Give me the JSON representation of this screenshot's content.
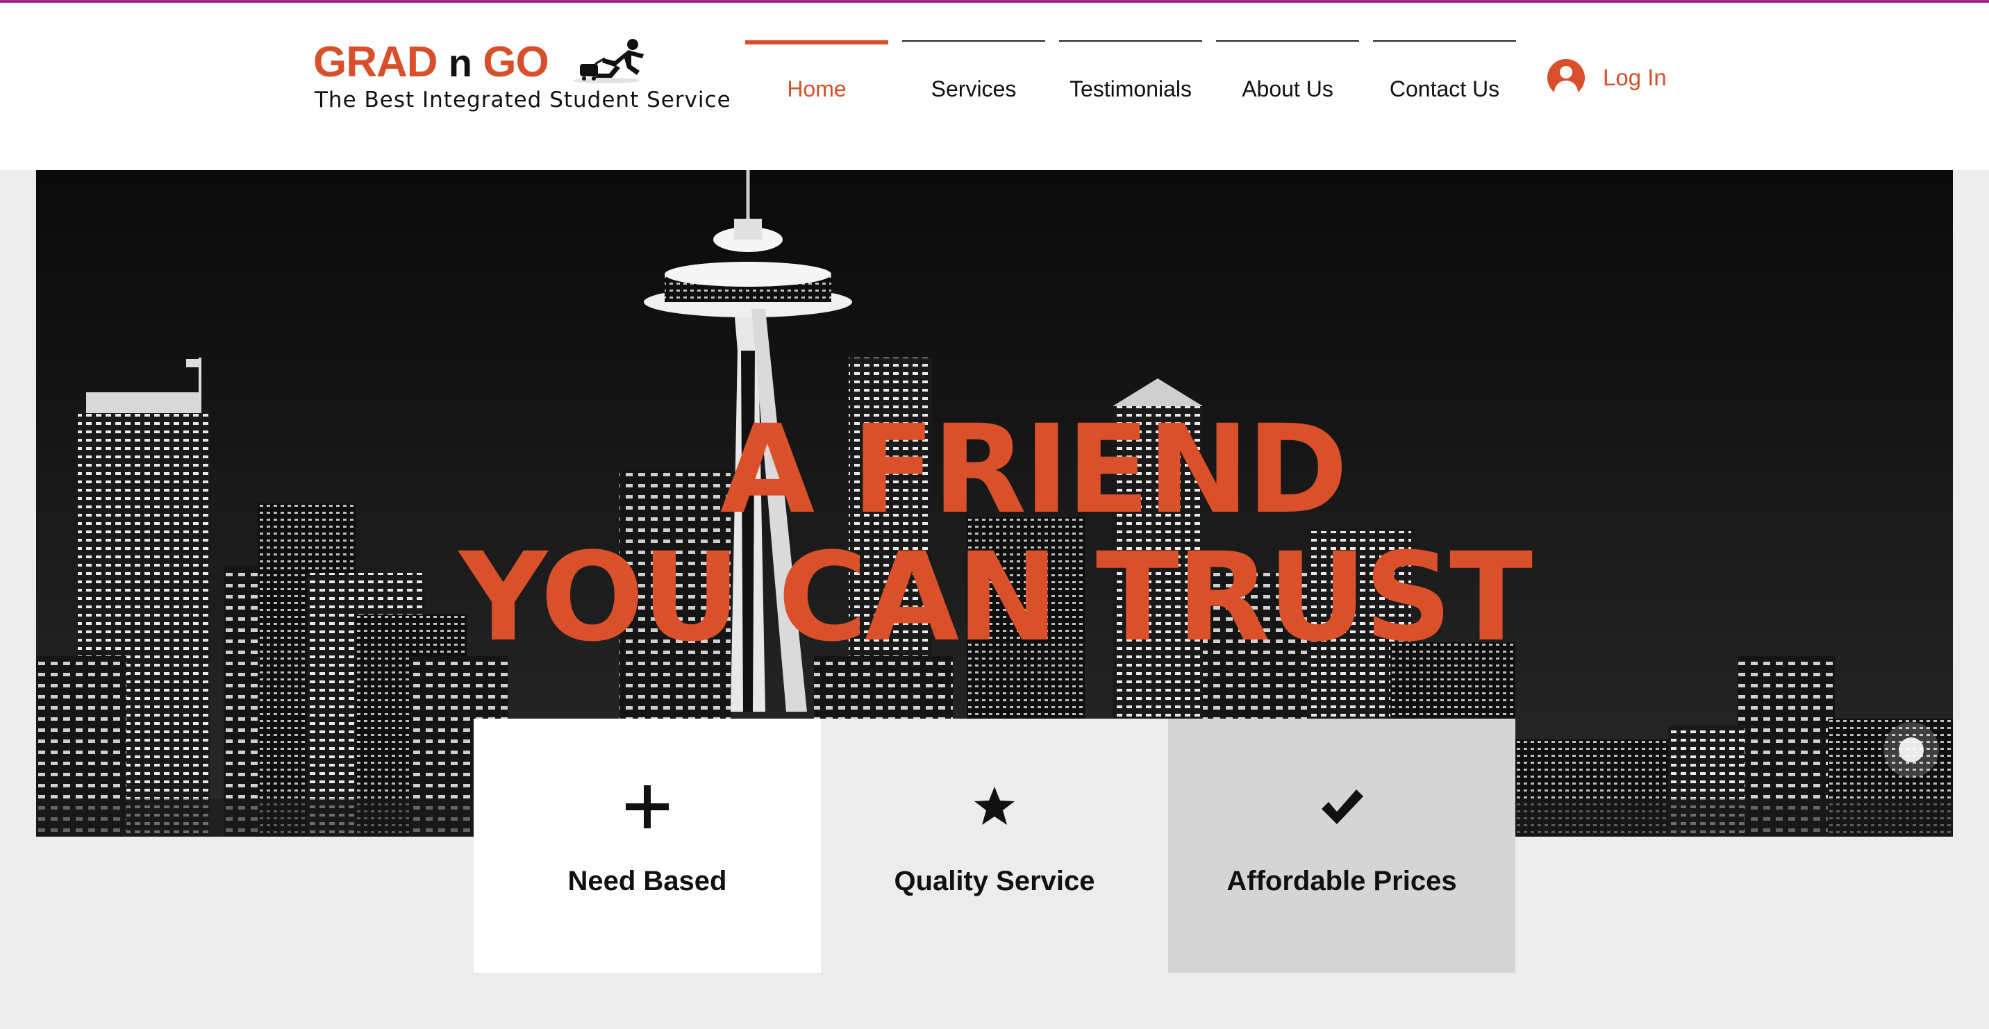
{
  "brand": {
    "name_part1": "GRAD",
    "name_part2": "n",
    "name_part3": "GO",
    "tagline": "The Best Integrated Student Service",
    "accent_color": "#d94f2b"
  },
  "nav": {
    "items": [
      {
        "label": "Home",
        "active": true
      },
      {
        "label": "Services",
        "active": false
      },
      {
        "label": "Testimonials",
        "active": false
      },
      {
        "label": "About Us",
        "active": false
      },
      {
        "label": "Contact Us",
        "active": false
      }
    ],
    "login_label": "Log In",
    "login_icon": "user-avatar-icon"
  },
  "hero": {
    "line1": "A FRIEND",
    "line2": "YOU CAN TRUST",
    "background": "night city skyline with space needle"
  },
  "features": [
    {
      "icon": "plus-icon",
      "label": "Need Based",
      "bg": "#ffffff"
    },
    {
      "icon": "star-icon",
      "label": "Quality Service",
      "bg": "#ececec"
    },
    {
      "icon": "check-icon",
      "label": "Affordable Prices",
      "bg": "#d5d5d5"
    }
  ]
}
